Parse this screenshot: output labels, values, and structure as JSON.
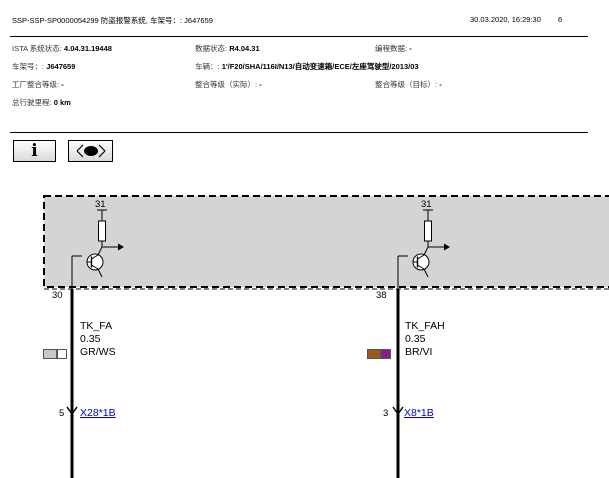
{
  "header": {
    "title": "SSP-SSP-SP0000054299 防盗报警系统, 车架号：: J647659",
    "datetime": "30.03.2020, 16:29:30",
    "page": "6"
  },
  "info": {
    "ista_label": "ISTA 系统状态:",
    "ista_value": "4.04.31.19448",
    "data_label": "数据状态:",
    "data_value": "R4.04.31",
    "prog_label": "编程数据:",
    "prog_value": "-",
    "vin_label": "车架号：:",
    "vin_value": "J647659",
    "vehicle_label": "车辆：:",
    "vehicle_value": "1'/F20/SHA/116I/N13/自动变速箱/ECE/左座驾驶型/2013/03",
    "factory_label": "工厂整合等级:",
    "factory_value": "-",
    "actual_label": "整合等级（实际）:",
    "actual_value": "-",
    "target_label": "整合等级（目标）:",
    "target_value": "-",
    "mileage_label": "总行驶里程:",
    "mileage_value": "0 km"
  },
  "toolbar": {
    "info_label": "i",
    "info_icon": "info-icon",
    "view_icon": "eye-icon"
  },
  "diagram": {
    "left": {
      "ground_label": "31",
      "pin": "30",
      "wire_name": "TK_FA",
      "wire_size": "0.35",
      "wire_color": "GR/WS",
      "swatch_colors": [
        "#c8c8c8",
        "#ffffff"
      ],
      "conn_pin": "5",
      "connector": "X28*1B"
    },
    "right": {
      "ground_label": "31",
      "pin": "38",
      "wire_name": "TK_FAH",
      "wire_size": "0.35",
      "wire_color": "BR/VI",
      "swatch_colors": [
        "#9b5a1e",
        "#8b1a8b"
      ],
      "conn_pin": "3",
      "connector": "X8*1B"
    },
    "module_fill": "#d4d4d4"
  }
}
